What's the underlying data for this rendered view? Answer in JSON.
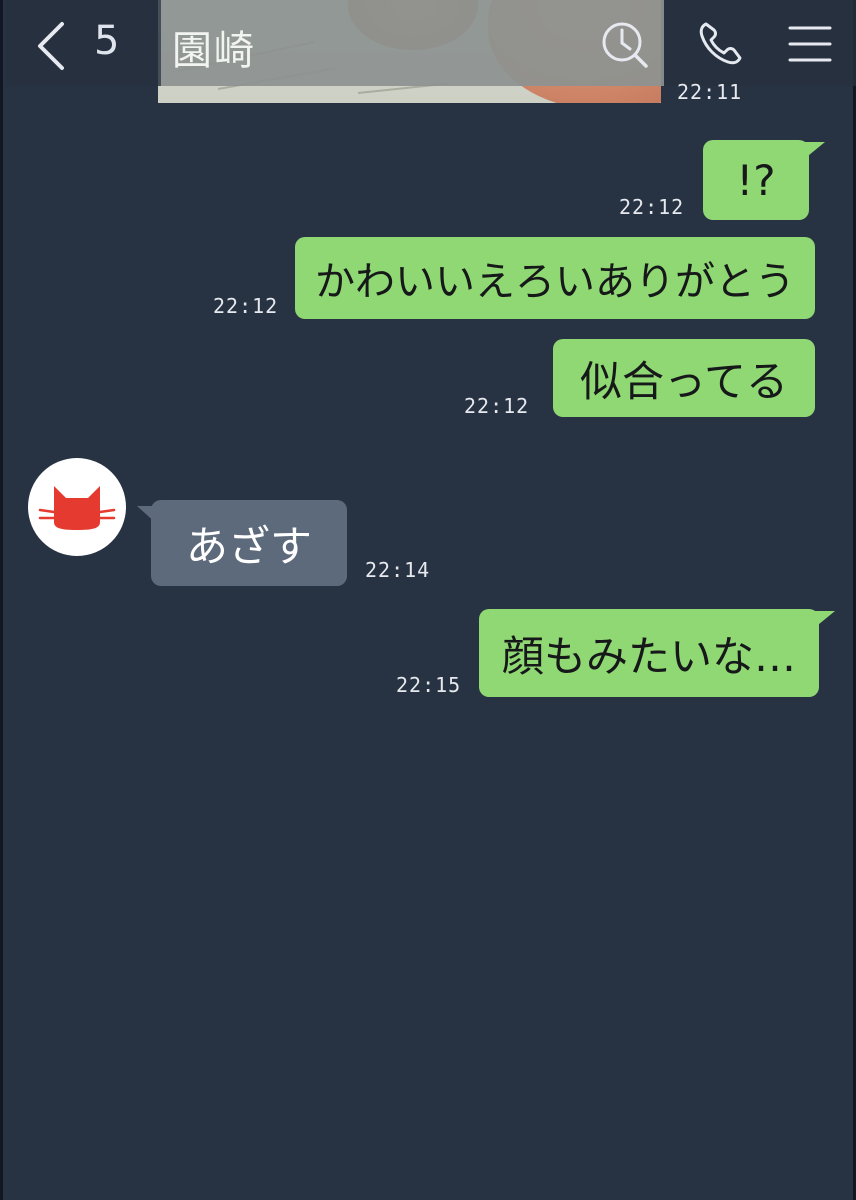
{
  "header": {
    "back_icon": "chevron-left-icon",
    "unread_count": "5",
    "chat_name": "園崎",
    "icons": [
      "search-history-icon",
      "phone-icon",
      "menu-icon"
    ]
  },
  "messages": [
    {
      "direction": "outgoing",
      "text": "",
      "time": "22:11",
      "type": "image"
    },
    {
      "direction": "outgoing",
      "text": "!?",
      "time": "22:12"
    },
    {
      "direction": "outgoing",
      "text": "かわいいえろいありがとう",
      "time": "22:12"
    },
    {
      "direction": "outgoing",
      "text": "似合ってる",
      "time": "22:12"
    },
    {
      "direction": "incoming",
      "text": "あざす",
      "time": "22:14",
      "avatar": "red-cat-icon"
    },
    {
      "direction": "outgoing",
      "text": "顔もみたいな…",
      "time": "22:15"
    }
  ],
  "colors": {
    "background": "#273243",
    "outgoing_bubble": "#8fd873",
    "incoming_bubble": "#5d6a7b",
    "avatar_cat": "#e53a30"
  }
}
